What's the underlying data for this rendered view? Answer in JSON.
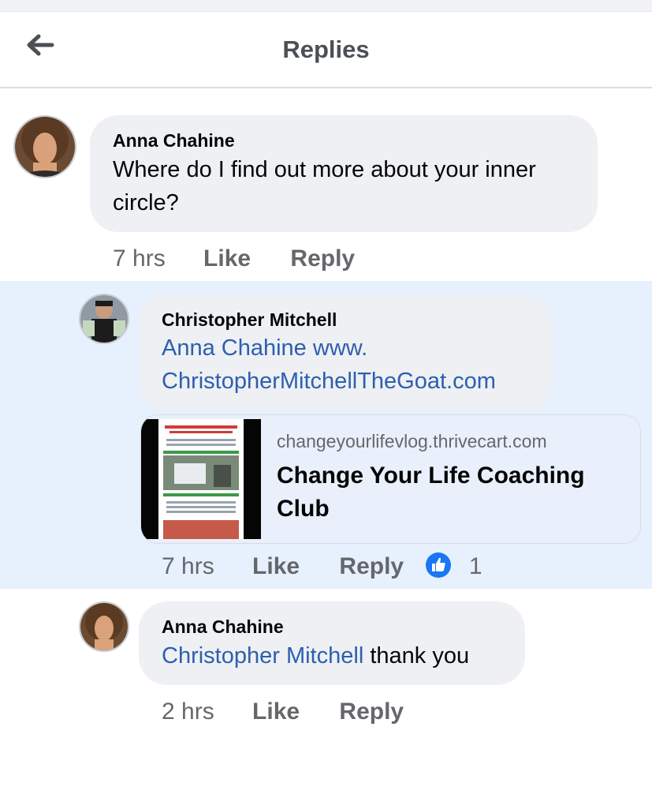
{
  "header": {
    "title": "Replies",
    "back_icon": "arrow-left-icon"
  },
  "comments": [
    {
      "author": "Anna Chahine",
      "text": "Where do I find out more about your inner circle?",
      "time": "7 hrs",
      "like_label": "Like",
      "reply_label": "Reply"
    },
    {
      "author": "Christopher Mitchell",
      "mention": "Anna Chahine",
      "link_text": "www. ChristopherMitchellTheGoat.com",
      "time": "7 hrs",
      "like_label": "Like",
      "reply_label": "Reply",
      "reaction_count": "1",
      "reaction_icon": "thumbs-up-icon",
      "link_preview": {
        "domain": "changeyourlifevlog.thrivecart.com",
        "title": "Change Your Life Coaching Club"
      }
    },
    {
      "author": "Anna Chahine",
      "mention": "Christopher Mitchell",
      "text": "thank you",
      "time": "2 hrs",
      "like_label": "Like",
      "reply_label": "Reply"
    }
  ],
  "colors": {
    "link": "#2d5fae",
    "highlight": "#e7f0fd",
    "bubble": "#eef0f3",
    "like_blue": "#1877f2"
  }
}
